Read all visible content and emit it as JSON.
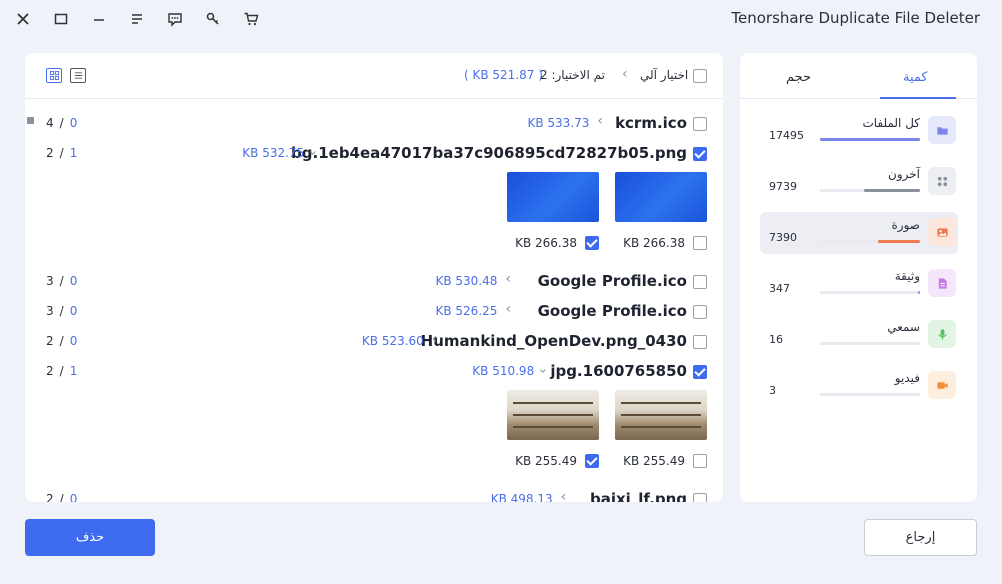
{
  "app_title": "Tenorshare Duplicate File Deleter",
  "header": {
    "auto_select": "اختيار آلي",
    "selected_label": "تم الاختيار: 2",
    "selected_size": "( KB 521.87 )"
  },
  "rows": [
    {
      "name": "kcrm.ico",
      "size": "KB 533.73",
      "selected": "0",
      "total": "4",
      "checked": false,
      "expanded": false
    },
    {
      "name": "bg.1eb4ea47017ba37c906895cd72827b05.png",
      "size": "KB 532.75",
      "selected": "1",
      "total": "2",
      "checked": true,
      "expanded": true,
      "thumbs": [
        {
          "size": "KB 266.38",
          "checked": false
        },
        {
          "size": "KB 266.38",
          "checked": true
        }
      ]
    },
    {
      "name": "Google Profile.ico",
      "size": "KB 530.48",
      "selected": "0",
      "total": "3",
      "checked": false,
      "expanded": false
    },
    {
      "name": "Google Profile.ico",
      "size": "KB 526.25",
      "selected": "0",
      "total": "3",
      "checked": false,
      "expanded": false
    },
    {
      "name": "Humankind_OpenDev.png_0430",
      "size": "KB 523.60",
      "selected": "0",
      "total": "2",
      "checked": false,
      "expanded": false
    },
    {
      "name": "jpg.1600765850",
      "size": "KB 510.98",
      "selected": "1",
      "total": "2",
      "checked": true,
      "expanded": true,
      "thumbs": [
        {
          "size": "KB 255.49",
          "checked": false
        },
        {
          "size": "KB 255.49",
          "checked": true
        }
      ]
    },
    {
      "name": "baixi_lf.png",
      "size": "KB 498.13",
      "selected": "0",
      "total": "2",
      "checked": false,
      "expanded": false
    }
  ],
  "sidebar": {
    "tab_quantity": "كمية",
    "tab_size": "حجم",
    "categories": [
      {
        "label": "كل الملفات",
        "count": "17495",
        "fill_pct": 100,
        "icon": "folder-icon",
        "color": "#7b84e8"
      },
      {
        "label": "آخرون",
        "count": "9739",
        "fill_pct": 56,
        "icon": "grid-icon",
        "color": "#8a909c"
      },
      {
        "label": "صورة",
        "count": "7390",
        "fill_pct": 42,
        "icon": "image-icon",
        "color": "#f07a50"
      },
      {
        "label": "وثيقة",
        "count": "347",
        "fill_pct": 2,
        "icon": "document-icon",
        "color": "#c77be8"
      },
      {
        "label": "سمعي",
        "count": "16",
        "fill_pct": 0,
        "icon": "microphone-icon",
        "color": "#4fc25a"
      },
      {
        "label": "فيديو",
        "count": "3",
        "fill_pct": 0,
        "icon": "video-icon",
        "color": "#f0903a"
      }
    ]
  },
  "buttons": {
    "delete": "حذف",
    "back": "إرجاع"
  }
}
